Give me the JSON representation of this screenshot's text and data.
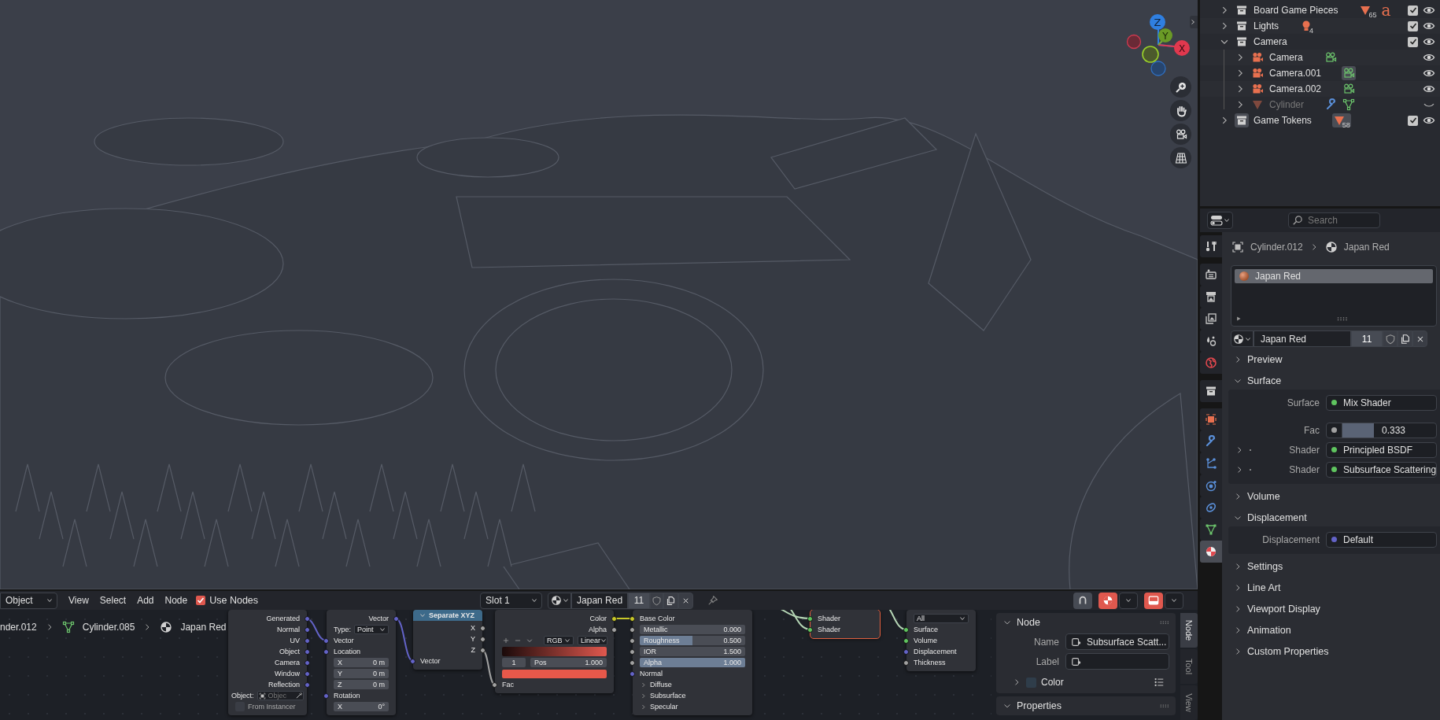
{
  "viewport": {
    "axis_labels": [
      "Z",
      "Y",
      "X"
    ]
  },
  "outliner": {
    "rows": [
      {
        "kind": "collection",
        "name": "Board Game Pieces",
        "expanded": false,
        "checked": true,
        "visible": true,
        "disabled": false,
        "active": false,
        "badges": [
          {
            "kind": "mesh",
            "count": "65",
            "highlighted": false
          },
          {
            "kind": "text",
            "glyph": "a",
            "highlighted": false
          }
        ]
      },
      {
        "kind": "collection",
        "name": "Lights",
        "expanded": false,
        "checked": true,
        "visible": true,
        "disabled": false,
        "active": false,
        "badges": [
          {
            "kind": "light",
            "count": "4",
            "highlighted": false
          }
        ]
      },
      {
        "kind": "collection",
        "name": "Camera",
        "expanded": true,
        "checked": true,
        "visible": true,
        "disabled": false,
        "active": false,
        "children": [
          {
            "kind": "camera",
            "name": "Camera",
            "expanded": false,
            "visible": true,
            "disabled": false,
            "active": false,
            "badges": [
              {
                "kind": "camera-data",
                "highlighted": false
              }
            ]
          },
          {
            "kind": "camera",
            "name": "Camera.001",
            "expanded": false,
            "visible": true,
            "disabled": false,
            "active": false,
            "badges": [
              {
                "kind": "camera-data",
                "highlighted": true
              }
            ]
          },
          {
            "kind": "camera",
            "name": "Camera.002",
            "expanded": false,
            "visible": true,
            "disabled": false,
            "active": false,
            "badges": [
              {
                "kind": "camera-data",
                "highlighted": false
              }
            ]
          },
          {
            "kind": "mesh",
            "name": "Cylinder",
            "expanded": false,
            "visible": false,
            "disabled": true,
            "active": false,
            "badges": [
              {
                "kind": "wrench",
                "highlighted": false
              },
              {
                "kind": "mesh-data",
                "highlighted": false
              }
            ]
          }
        ]
      },
      {
        "kind": "collection",
        "name": "Game Tokens",
        "expanded": false,
        "checked": true,
        "visible": true,
        "disabled": false,
        "active": true,
        "badges": [
          {
            "kind": "mesh",
            "count": "58",
            "highlighted": true
          }
        ]
      }
    ]
  },
  "properties": {
    "search": {
      "placeholder": "Search"
    },
    "tabs": [
      {
        "kind": "tool",
        "selected": false
      },
      {
        "kind": "render",
        "selected": false
      },
      {
        "kind": "output",
        "selected": false
      },
      {
        "kind": "view-layer",
        "selected": false
      },
      {
        "kind": "scene",
        "selected": false
      },
      {
        "kind": "world",
        "selected": false
      },
      {
        "kind": "collection",
        "selected": false
      },
      {
        "kind": "object-tab",
        "selected": false
      },
      {
        "kind": "modifiers",
        "selected": false
      },
      {
        "kind": "particles",
        "selected": false
      },
      {
        "kind": "physics",
        "selected": false
      },
      {
        "kind": "constraints",
        "selected": false
      },
      {
        "kind": "data",
        "selected": false
      },
      {
        "kind": "material-tab",
        "selected": true
      }
    ],
    "breadcrumb": [
      {
        "kind": "object",
        "label": "Cylinder.012"
      },
      {
        "kind": "material",
        "label": "Japan Red"
      }
    ],
    "slots": [
      {
        "label": "Japan Red",
        "selected": true
      }
    ],
    "id_block": {
      "name": "Japan Red",
      "users": "11"
    },
    "panels": [
      {
        "title": "Preview",
        "expanded": false
      },
      {
        "title": "Surface",
        "expanded": true,
        "rows": [
          {
            "kind": "socket",
            "label": "Surface",
            "value": "Mix Shader",
            "color": "#5fc45f",
            "expandable": false
          },
          {
            "kind": "slider",
            "label": "Fac",
            "value": "0.333",
            "level": 0.333,
            "color": "#a1a1a1",
            "expandable": false
          },
          {
            "kind": "socket",
            "label": "Shader",
            "value": "Principled BSDF",
            "color": "#5fc45f",
            "expandable": true
          },
          {
            "kind": "socket",
            "label": "Shader",
            "value": "Subsurface Scattering",
            "color": "#5fc45f",
            "expandable": true
          }
        ]
      },
      {
        "title": "Volume",
        "expanded": false
      },
      {
        "title": "Displacement",
        "expanded": true,
        "rows": [
          {
            "kind": "socket",
            "label": "Displacement",
            "value": "Default",
            "color": "#6363c7",
            "expandable": false
          }
        ]
      },
      {
        "title": "Settings",
        "expanded": false
      },
      {
        "title": "Line Art",
        "expanded": false
      },
      {
        "title": "Viewport Display",
        "expanded": false
      },
      {
        "title": "Animation",
        "expanded": false
      },
      {
        "title": "Custom Properties",
        "expanded": false
      }
    ]
  },
  "node_editor": {
    "header": {
      "mode": "Object",
      "menus": [
        "View",
        "Select",
        "Add",
        "Node"
      ],
      "use_nodes": {
        "label": "Use Nodes",
        "checked": true
      },
      "slot": "Slot 1",
      "material": {
        "name": "Japan Red",
        "users": "11"
      }
    },
    "breadcrumb": [
      {
        "label": "nder.012"
      },
      {
        "kind": "mesh-data",
        "label": "Cylinder.085"
      },
      {
        "kind": "material",
        "label": "Japan Red"
      }
    ],
    "nodes": [
      {
        "selected": false,
        "rows": [
          {
            "kind": "output",
            "label": "Generated",
            "color": "#6363c7"
          },
          {
            "kind": "output",
            "label": "Normal",
            "color": "#6363c7"
          },
          {
            "kind": "output",
            "label": "UV",
            "color": "#6363c7"
          },
          {
            "kind": "output",
            "label": "Object",
            "color": "#6363c7"
          },
          {
            "kind": "output",
            "label": "Camera",
            "color": "#6363c7"
          },
          {
            "kind": "output",
            "label": "Window",
            "color": "#6363c7"
          },
          {
            "kind": "output",
            "label": "Reflection",
            "color": "#6363c7"
          },
          {
            "kind": "object-field",
            "label": "Object:",
            "placeholder": "Objec"
          },
          {
            "kind": "checkbox",
            "label": "From Instancer",
            "checked": false
          }
        ]
      },
      {
        "selected": false,
        "rows": [
          {
            "kind": "output",
            "label": "Vector",
            "color": "#6363c7"
          },
          {
            "kind": "dropdown",
            "label": "Type:",
            "value": "Point"
          },
          {
            "kind": "input",
            "label": "Vector",
            "color": "#6363c7"
          },
          {
            "kind": "input",
            "label": "Location",
            "color": "#6363c7"
          },
          {
            "kind": "field",
            "label": "X",
            "value": "0 m"
          },
          {
            "kind": "field",
            "label": "Y",
            "value": "0 m"
          },
          {
            "kind": "field",
            "label": "Z",
            "value": "0 m"
          },
          {
            "kind": "input",
            "label": "Rotation",
            "color": "#6363c7"
          },
          {
            "kind": "field",
            "label": "X",
            "value": "0°"
          }
        ]
      },
      {
        "selected": false,
        "title": "Separate XYZ",
        "rows": [
          {
            "kind": "output",
            "label": "X",
            "color": "#a1a1a1"
          },
          {
            "kind": "output",
            "label": "Y",
            "color": "#a1a1a1"
          },
          {
            "kind": "output",
            "label": "Z",
            "color": "#a1a1a1"
          },
          {
            "kind": "input",
            "label": "Vector",
            "color": "#6363c7"
          }
        ]
      },
      {
        "selected": false,
        "rows": [
          {
            "kind": "output",
            "label": "Color",
            "color": "#c7c729"
          },
          {
            "kind": "output",
            "label": "Alpha",
            "color": "#a1a1a1"
          },
          {
            "kind": "ramp-controls",
            "mode": "RGB",
            "interpolation": "Linear"
          },
          {
            "kind": "ramp"
          },
          {
            "kind": "stop",
            "index": "1",
            "label": "Pos",
            "value": "1.000"
          },
          {
            "kind": "swatch",
            "color": "#e8584a"
          },
          {
            "kind": "input",
            "label": "Fac",
            "color": "#a1a1a1"
          }
        ]
      },
      {
        "selected": false,
        "rows": [
          {
            "kind": "input",
            "label": "Base Color",
            "color": "#c7c729"
          },
          {
            "kind": "slider",
            "label": "Metallic",
            "value": "0.000",
            "level": 0,
            "color": "#a1a1a1"
          },
          {
            "kind": "slider",
            "label": "Roughness",
            "value": "0.500",
            "level": 0.5,
            "color": "#a1a1a1"
          },
          {
            "kind": "slider",
            "label": "IOR",
            "value": "1.500",
            "level": 0,
            "color": "#a1a1a1"
          },
          {
            "kind": "slider",
            "label": "Alpha",
            "value": "1.000",
            "level": 1,
            "color": "#a1a1a1"
          },
          {
            "kind": "input",
            "label": "Normal",
            "color": "#6363c7"
          },
          {
            "kind": "panel",
            "label": "Diffuse",
            "expanded": false
          },
          {
            "kind": "panel",
            "label": "Subsurface",
            "expanded": false
          },
          {
            "kind": "panel",
            "label": "Specular",
            "expanded": false
          }
        ]
      },
      {
        "selected": true,
        "rows": [
          {
            "kind": "input",
            "label": "Shader",
            "color": "#5fc45f"
          },
          {
            "kind": "input",
            "label": "Shader",
            "color": "#5fc45f"
          }
        ]
      },
      {
        "selected": false,
        "rows": [
          {
            "kind": "dropdown",
            "value": "All"
          },
          {
            "kind": "input",
            "label": "Surface",
            "color": "#5fc45f"
          },
          {
            "kind": "input",
            "label": "Volume",
            "color": "#5fc45f"
          },
          {
            "kind": "input",
            "label": "Displacement",
            "color": "#6363c7"
          },
          {
            "kind": "input",
            "label": "Thickness",
            "color": "#a1a1a1"
          }
        ]
      }
    ],
    "sidebar": {
      "panels": [
        {
          "title": "Node",
          "expanded": true,
          "fields": [
            {
              "label": "Name",
              "value": "Subsurface Scatt..."
            },
            {
              "label": "Label"
            }
          ],
          "subpanels": [
            {
              "title": "Color",
              "expanded": false,
              "checked": false
            }
          ]
        },
        {
          "title": "Properties",
          "expanded": true
        }
      ]
    },
    "tabs": [
      {
        "label": "Node",
        "selected": true
      },
      {
        "label": "Tool",
        "selected": false
      },
      {
        "label": "View",
        "selected": false
      }
    ]
  }
}
